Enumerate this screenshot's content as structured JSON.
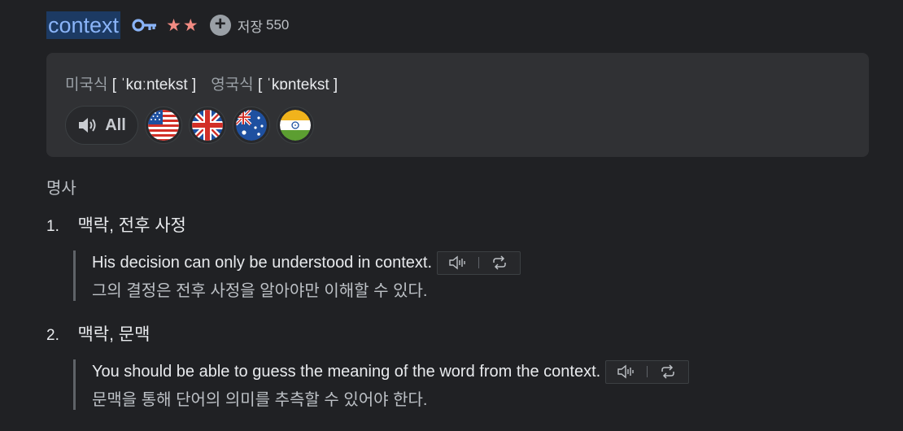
{
  "entry": {
    "word": "context",
    "stars": "★★",
    "save_label": "저장",
    "save_count": "550",
    "icons": {
      "key": "key-icon",
      "add": "plus-circle-icon"
    }
  },
  "pronunciation": {
    "us_label": "미국식",
    "us_ipa": "[ ˈkɑːntekst ]",
    "uk_label": "영국식",
    "uk_ipa": "[ ˈkɒntekst ]",
    "all_label": "All",
    "flags": [
      "us-flag-icon",
      "uk-flag-icon",
      "australia-flag-icon",
      "india-flag-icon"
    ]
  },
  "part_of_speech": "명사",
  "senses": [
    {
      "number": "1.",
      "meaning": "맥락, 전후 사정",
      "example_en": "His decision can only be understood in context.",
      "example_ko": "그의 결정은 전후 사정을 알아야만 이해할 수 있다."
    },
    {
      "number": "2.",
      "meaning": "맥락, 문맥",
      "example_en": "You should be able to guess the meaning of the word from the context.",
      "example_ko": "문맥을 통해 단어의 의미를 추측할 수 있어야 한다."
    }
  ],
  "colors": {
    "background": "#202124",
    "word": "#8ab4f8",
    "word_highlight": "#1c3a63",
    "key": "#8ab4f8",
    "stars": "#f28b82",
    "panel": "#303134"
  }
}
